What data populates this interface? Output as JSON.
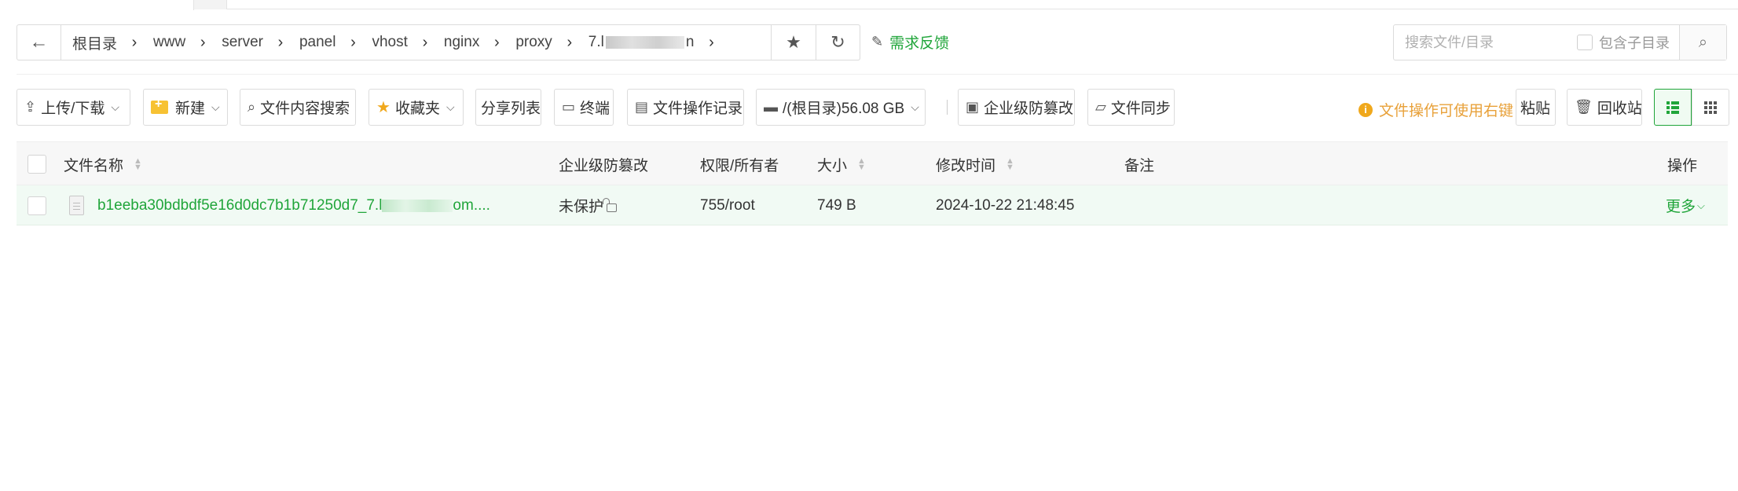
{
  "breadcrumb": {
    "items": [
      {
        "label": "根目录"
      },
      {
        "label": "www"
      },
      {
        "label": "server"
      },
      {
        "label": "panel"
      },
      {
        "label": "vhost"
      },
      {
        "label": "nginx"
      },
      {
        "label": "proxy"
      },
      {
        "label": "7.l",
        "label_end": "n"
      }
    ]
  },
  "header": {
    "feedback_label": "需求反馈",
    "search_placeholder": "搜索文件/目录",
    "include_subdir_label": "包含子目录"
  },
  "toolbar": {
    "upload_label": "上传/下载",
    "new_label": "新建",
    "content_search_label": "文件内容搜索",
    "favorites_label": "收藏夹",
    "share_list_label": "分享列表",
    "terminal_label": "终端",
    "operation_log_label": "文件操作记录",
    "disk_label": "/(根目录)56.08 GB",
    "tamper_label": "企业级防篡改",
    "sync_label": "文件同步",
    "tip_label": "文件操作可使用右键",
    "paste_label": "粘贴",
    "recycle_label": "回收站"
  },
  "table": {
    "columns": {
      "name": "文件名称",
      "tamper": "企业级防篡改",
      "perm": "权限/所有者",
      "size": "大小",
      "mtime": "修改时间",
      "remark": "备注",
      "ops": "操作"
    },
    "rows": [
      {
        "name_prefix": "b1eeba30bdbdf5e16d0dc7b1b71250d7_7.l",
        "name_suffix": "om....",
        "tamper": "未保护",
        "perm": "755/root",
        "size": "749 B",
        "mtime": "2024-10-22 21:48:45",
        "remark": "",
        "ops": "更多"
      }
    ]
  },
  "colors": {
    "accent": "#20a53a",
    "warning": "#e8a13a"
  },
  "icons": [
    "back-arrow-icon",
    "chevron-right-icon",
    "star-icon",
    "refresh-icon",
    "feedback-icon",
    "search-icon",
    "upload-icon",
    "folder-plus-icon",
    "magnifier-icon",
    "terminal-icon",
    "log-icon",
    "disk-icon",
    "shield-icon",
    "sync-folder-icon",
    "info-icon",
    "trash-icon",
    "list-view-icon",
    "grid-view-icon",
    "file-icon",
    "lock-icon",
    "sort-icon"
  ]
}
